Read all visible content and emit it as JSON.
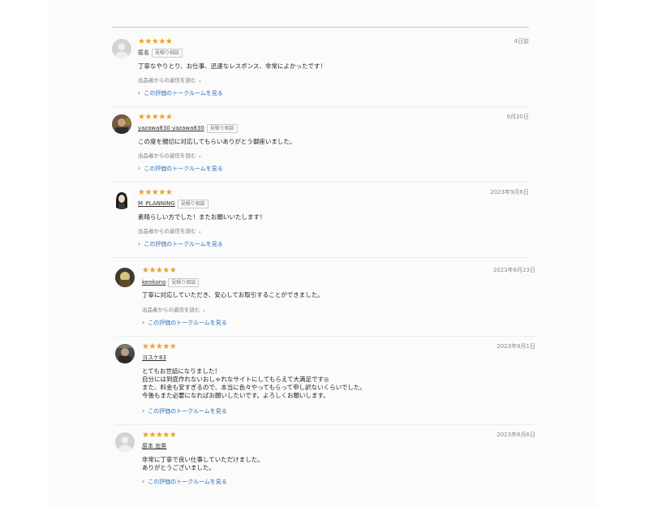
{
  "reviews": [
    {
      "stars": "★★★★★",
      "user": "匿名",
      "badge": "見積り相談",
      "date": "4日前",
      "lines": [
        "丁寧なやりとり、お仕事、迅速なレスポンス、非常によかったです！"
      ],
      "reply_toggle": "出品者からの返信を読む ⌄",
      "talk_link": "この評価のトークルームを見る",
      "avatar": "default-avatar"
    },
    {
      "stars": "★★★★★",
      "user": "yazawa830 yazawa830",
      "badge": "見積り相談",
      "date": "9月20日",
      "lines": [
        "この度を親切に対応してもらいありがとう御座いました。"
      ],
      "reply_toggle": "出品者からの返信を読む ⌄",
      "talk_link": "この評価のトークルームを見る",
      "avatar": "user-photo"
    },
    {
      "stars": "★★★★★",
      "user": "M_PLANNING",
      "badge": "見積り相談",
      "date": "2023年9月6日",
      "lines": [
        "素晴らしい方でした！またお願いいたします！"
      ],
      "reply_toggle": "出品者からの返信を読む ⌄",
      "talk_link": "この評価のトークルームを見る",
      "avatar": "user-photo"
    },
    {
      "stars": "★★★★★",
      "user": "kenkono",
      "badge": "見積り相談",
      "date": "2023年8月23日",
      "lines": [
        "丁寧に対応していただき、安心してお取引することができました。"
      ],
      "reply_toggle": "出品者からの返信を読む ⌄",
      "talk_link": "この評価のトークルームを見る",
      "avatar": "user-photo"
    },
    {
      "stars": "★★★★★",
      "user": "ヨスケ83",
      "badge": "",
      "date": "2023年8月1日",
      "lines": [
        "とてもお世話になりました！",
        "自分には到底作れないおしゃれなサイトにしてもらえて大満足です◎",
        "また、料金も安すぎるので、本当に色々やってもらって申し訳ないくらいでした。",
        "今後もまた必要になればお願いしたいです。よろしくお願いします。"
      ],
      "reply_toggle": "",
      "talk_link": "この評価のトークルームを見る",
      "avatar": "user-photo"
    },
    {
      "stars": "★★★★★",
      "user": "原本 忠男",
      "badge": "",
      "date": "2023年6月6日",
      "lines": [
        "非常に丁寧で良い仕事していただけました。",
        "ありがとうございました。"
      ],
      "reply_toggle": "",
      "talk_link": "この評価のトークルームを見る",
      "avatar": "default-avatar"
    }
  ]
}
